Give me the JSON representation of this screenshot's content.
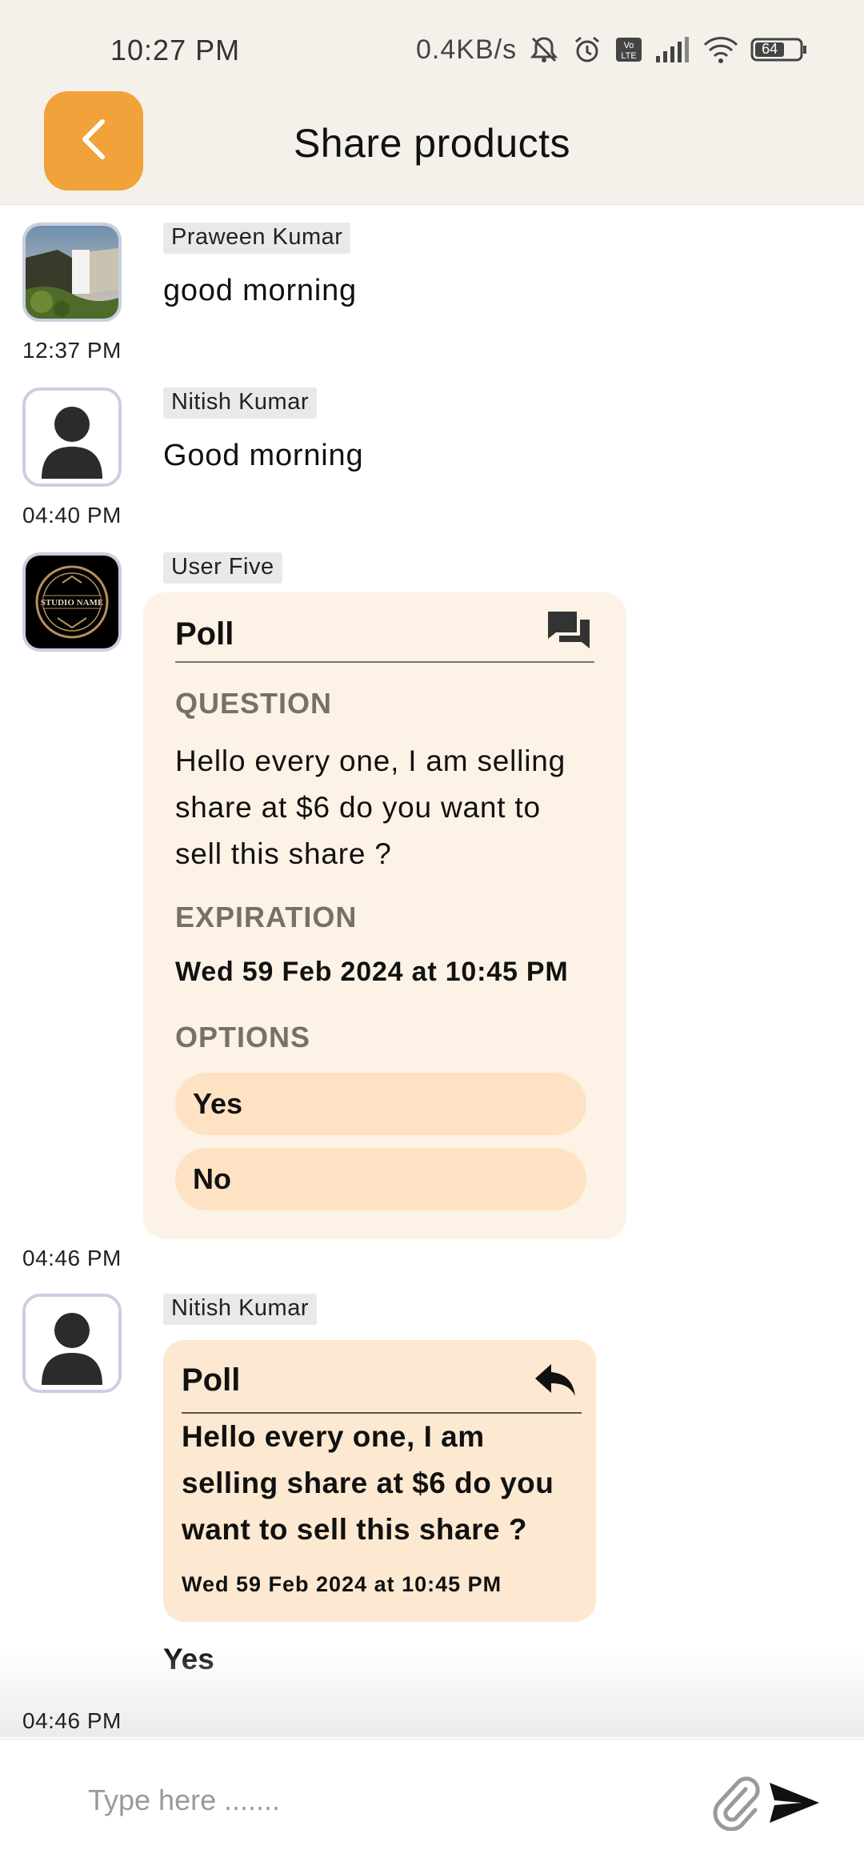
{
  "status_bar": {
    "time": "10:27 PM",
    "net_speed": "0.4KB/s",
    "battery": "64"
  },
  "header": {
    "title": "Share products"
  },
  "messages": [
    {
      "sender": "Praween Kumar",
      "text": "good morning",
      "time": "12:37 PM"
    },
    {
      "sender": "Nitish Kumar",
      "text": "Good morning",
      "time": "04:40 PM"
    },
    {
      "sender": "User Five",
      "time": "04:46 PM",
      "poll": {
        "title": "Poll",
        "question_label": "QUESTION",
        "question": "Hello every one, I am selling share at $6 do you want to sell this share ?",
        "expiration_label": "EXPIRATION",
        "expiration": "Wed 59 Feb 2024 at 10:45 PM",
        "options_label": "OPTIONS",
        "options": [
          "Yes",
          "No"
        ]
      }
    },
    {
      "sender": "Nitish Kumar",
      "time": "04:46 PM",
      "reply": {
        "title": "Poll",
        "question": "Hello every one, I am selling share at $6 do you want to sell this share ?",
        "expiration": "Wed 59 Feb 2024 at 10:45 PM",
        "answer": "Yes"
      }
    }
  ],
  "composer": {
    "placeholder": "Type here ......."
  },
  "colors": {
    "accent": "#f2a23a",
    "header_bg": "#f4f1eb",
    "poll_bg": "#fdf2e6",
    "option_bg": "#fde3c4",
    "reply_bg": "#fde9d1"
  }
}
